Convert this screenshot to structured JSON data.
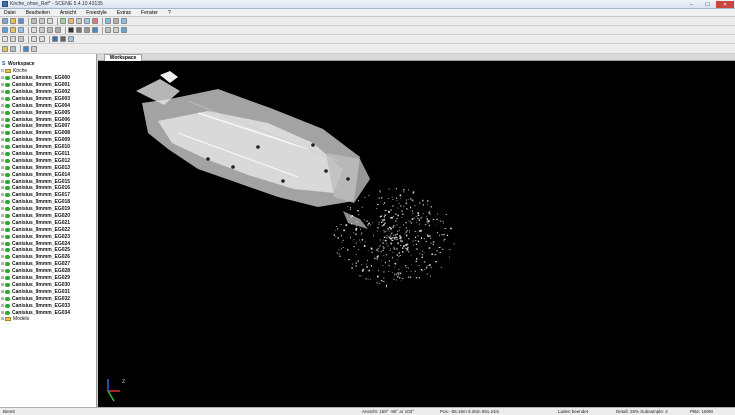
{
  "window": {
    "title": "Kirche_ohne_Ref* - SCENE 5.4.10.43135"
  },
  "menu": [
    "Datei",
    "Bearbeiten",
    "Ansicht",
    "Freestyle",
    "Extras",
    "Fenster",
    "?"
  ],
  "tree": {
    "workspace_label": "Workspace",
    "project_label": "Kirche",
    "items": [
      "Canisius_9mmm_EG000",
      "Canisius_9mmm_EG001",
      "Canisius_9mmm_EG002",
      "Canisius_9mmm_EG003",
      "Canisius_9mmm_EG004",
      "Canisius_9mmm_EG005",
      "Canisius_9mmm_EG006",
      "Canisius_9mmm_EG007",
      "Canisius_9mmm_EG008",
      "Canisius_9mmm_EG009",
      "Canisius_9mmm_EG010",
      "Canisius_9mmm_EG011",
      "Canisius_9mmm_EG012",
      "Canisius_9mmm_EG013",
      "Canisius_9mmm_EG014",
      "Canisius_9mmm_EG015",
      "Canisius_9mmm_EG016",
      "Canisius_9mmm_EG017",
      "Canisius_9mmm_EG018",
      "Canisius_9mmm_EG019",
      "Canisius_9mmm_EG020",
      "Canisius_9mmm_EG021",
      "Canisius_9mmm_EG022",
      "Canisius_9mmm_EG023",
      "Canisius_9mmm_EG024",
      "Canisius_9mmm_EG025",
      "Canisius_9mmm_EG026",
      "Canisius_9mmm_EG027",
      "Canisius_9mmm_EG028",
      "Canisius_9mmm_EG029",
      "Canisius_9mmm_EG030",
      "Canisius_9mmm_EG031",
      "Canisius_9mmm_EG032",
      "Canisius_9mmm_EG033",
      "Canisius_9mmm_EG034"
    ],
    "models_label": "Models"
  },
  "tabs": {
    "active": "Workspace"
  },
  "status": {
    "left": "Bereit",
    "view": "Ansicht: 159° -86° ar 103°",
    "pos": "Pos: -55.19m 9.26m 691.24m",
    "loading": "Laden beendet",
    "detail": "Detail: 25%  Subsample: 4",
    "points": "Pkte: 160M"
  },
  "colors": {
    "accent": "#3a6fb0",
    "scan_dot": "#2fa82f",
    "viewport": "#000000"
  }
}
